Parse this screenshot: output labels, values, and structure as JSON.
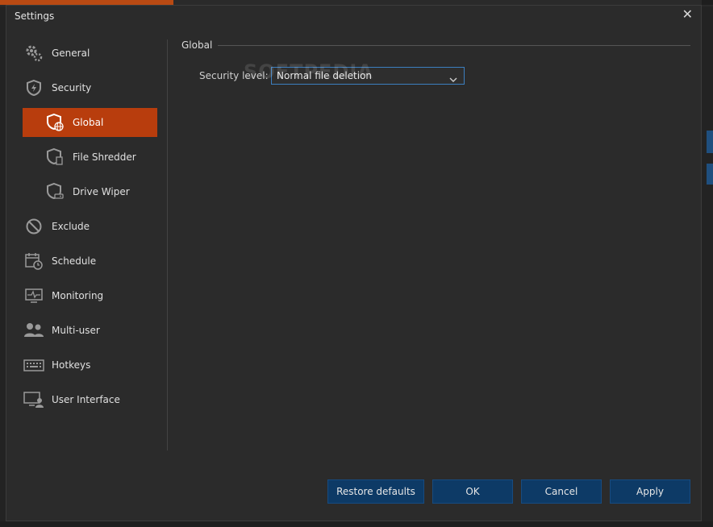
{
  "window": {
    "title": "Settings"
  },
  "sidebar": {
    "items": [
      {
        "label": "General",
        "icon": "gear-icon"
      },
      {
        "label": "Security",
        "icon": "shield-bolt-icon"
      },
      {
        "label": "Global",
        "icon": "shield-globe-icon",
        "active": true
      },
      {
        "label": "File Shredder",
        "icon": "shield-file-icon"
      },
      {
        "label": "Drive Wiper",
        "icon": "shield-drive-icon"
      },
      {
        "label": "Exclude",
        "icon": "prohibited-icon"
      },
      {
        "label": "Schedule",
        "icon": "calendar-clock-icon"
      },
      {
        "label": "Monitoring",
        "icon": "monitor-pulse-icon"
      },
      {
        "label": "Multi-user",
        "icon": "users-icon"
      },
      {
        "label": "Hotkeys",
        "icon": "keyboard-icon"
      },
      {
        "label": "User Interface",
        "icon": "monitor-user-icon"
      }
    ]
  },
  "main": {
    "section_title": "Global",
    "security_level": {
      "label": "Security level:",
      "value": "Normal file deletion"
    }
  },
  "watermark": "SOFTPEDIA",
  "buttons": {
    "restore": "Restore defaults",
    "ok": "OK",
    "cancel": "Cancel",
    "apply": "Apply"
  },
  "colors": {
    "accent": "#b83d0d",
    "button": "#0d3a66",
    "focus_border": "#3c7fc0"
  }
}
